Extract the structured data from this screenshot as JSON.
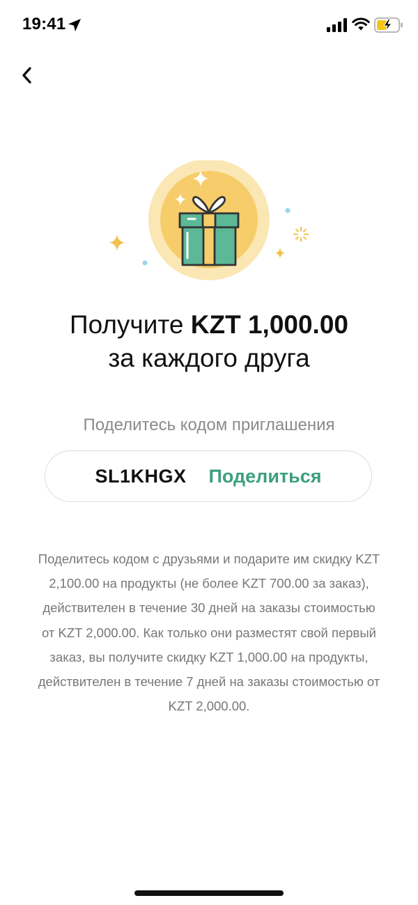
{
  "status_bar": {
    "time": "19:41"
  },
  "header": {
    "back_icon": "chevron-left-icon"
  },
  "illustration": {
    "icon": "gift-icon",
    "colors": {
      "circle_outer": "#fbe7b4",
      "circle_inner": "#f6cd6a",
      "box_green": "#5cb896",
      "ribbon_yellow": "#f6cd6a",
      "outline": "#333333"
    }
  },
  "headline": {
    "prefix": "Получите ",
    "amount": "KZT 1,000.00",
    "line2": "за каждого друга"
  },
  "share": {
    "label": "Поделитесь кодом приглашения",
    "code": "SL1KHGX",
    "button_label": "Поделиться",
    "accent_color": "#3c9f7e"
  },
  "description": {
    "text": "Поделитесь кодом с друзьями и подарите им скидку KZT 2,100.00 на продукты (не более KZT 700.00 за заказ), действителен в течение 30 дней на заказы стоимостью от KZT 2,000.00. Как только они разместят свой первый заказ, вы получите скидку KZT 1,000.00 на продукты, действителен в течение 7 дней на заказы стоимостью от KZT 2,000.00."
  }
}
